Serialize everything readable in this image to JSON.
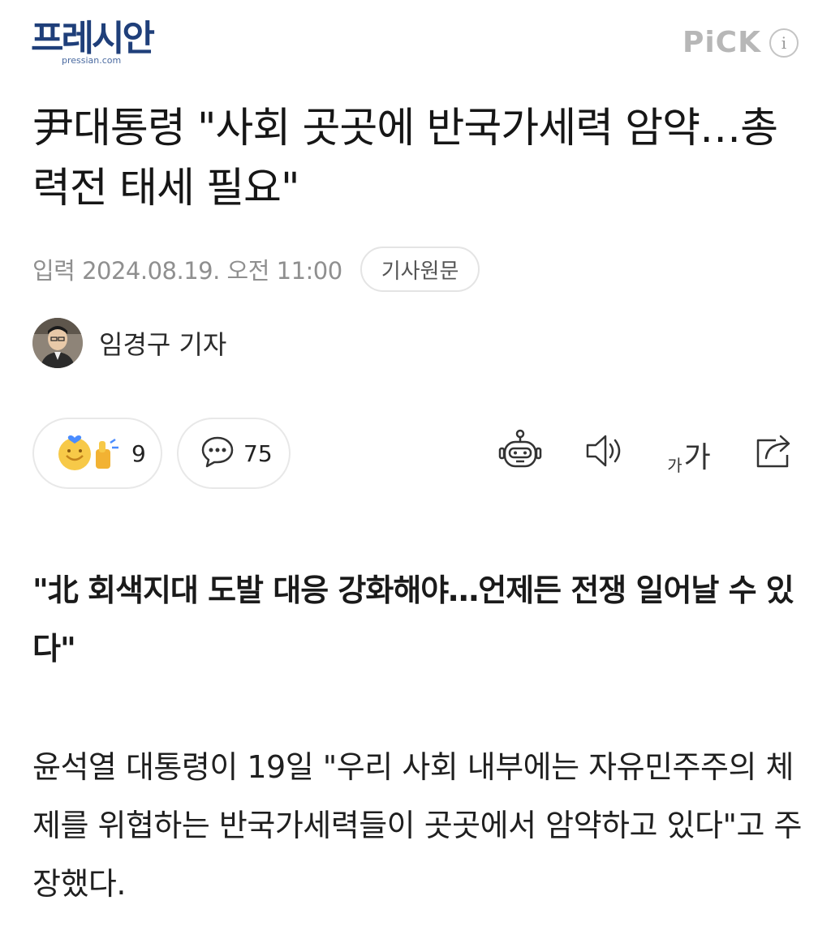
{
  "header": {
    "logo_text": "프레시안",
    "logo_sub": "pressian.com",
    "pick_label": "PiCK",
    "info_glyph": "i"
  },
  "article": {
    "title": "尹대통령 \"사회 곳곳에 반국가세력 암약…총력전 태세 필요\"",
    "date": "입력 2024.08.19. 오전 11:00",
    "original_button": "기사원문",
    "reporter": "임경구 기자",
    "subheadline": "\"北 회색지대 도발 대응 강화해야…언제든 전쟁 일어날 수 있다\"",
    "body": "윤석열 대통령이 19일 \"우리 사회 내부에는 자유민주주의 체제를 위협하는 반국가세력들이 곳곳에서 암약하고 있다\"고 주장했다."
  },
  "actions": {
    "reaction_count": "9",
    "comment_count": "75",
    "font_small": "가",
    "font_big": "가"
  },
  "icons": {
    "reaction": "reaction-emoji-icon",
    "comment": "comment-bubble-icon",
    "summary": "robot-summary-icon",
    "tts": "speaker-icon",
    "share": "share-icon"
  },
  "colors": {
    "logo": "#1f3f7a",
    "muted": "#8f8f8f",
    "emoji": "#f7c948",
    "heart": "#4a8cff"
  }
}
